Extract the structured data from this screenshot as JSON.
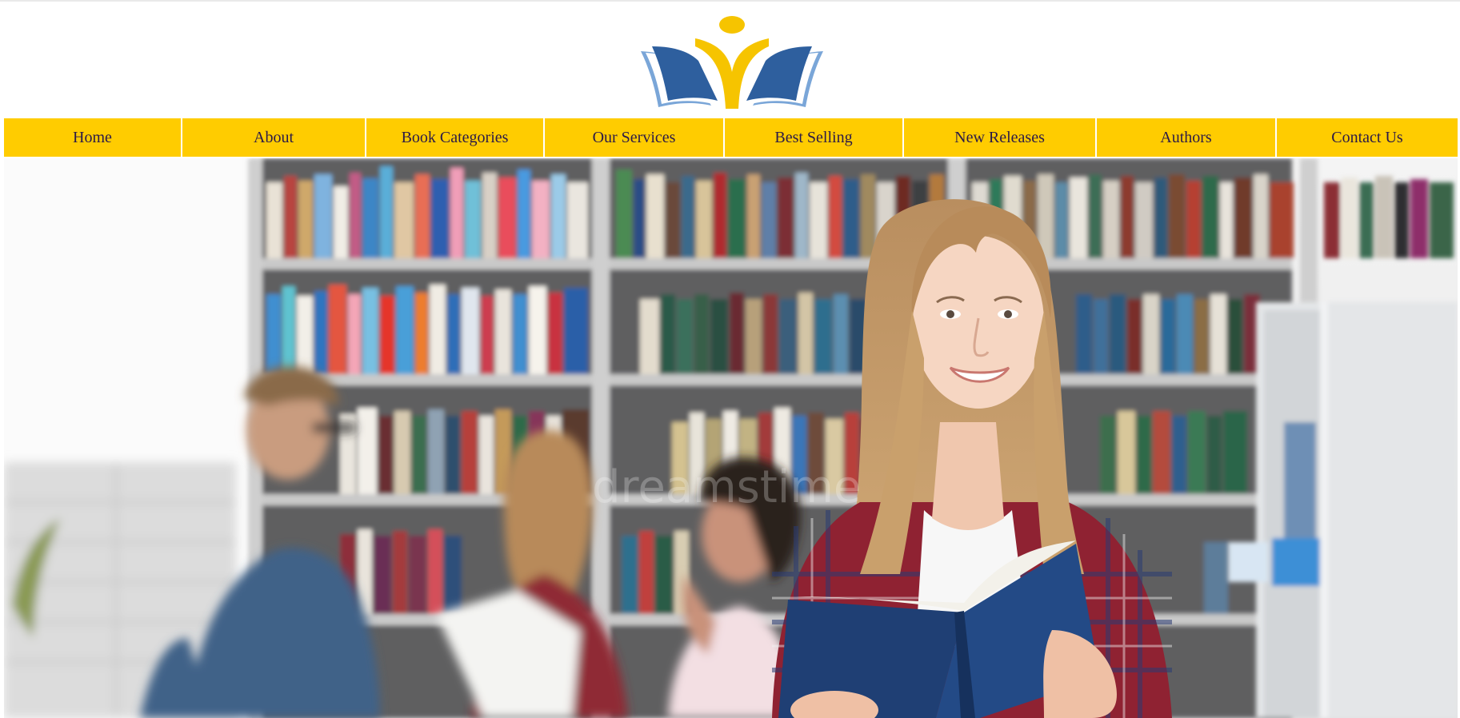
{
  "logo": {
    "icon": "open-book-reader-icon",
    "colors": {
      "blue": "#2e5f9e",
      "light_blue": "#7aa6d8",
      "yellow": "#f6c400"
    }
  },
  "nav": {
    "background": "#ffcc00",
    "text_color": "#2b1a48",
    "items": [
      {
        "label": "Home"
      },
      {
        "label": "About"
      },
      {
        "label": "Book Categories"
      },
      {
        "label": "Our Services"
      },
      {
        "label": "Best Selling"
      },
      {
        "label": "New Releases"
      },
      {
        "label": "Authors"
      },
      {
        "label": "Contact Us"
      }
    ]
  },
  "hero": {
    "image": "student-holding-book-in-library"
  }
}
